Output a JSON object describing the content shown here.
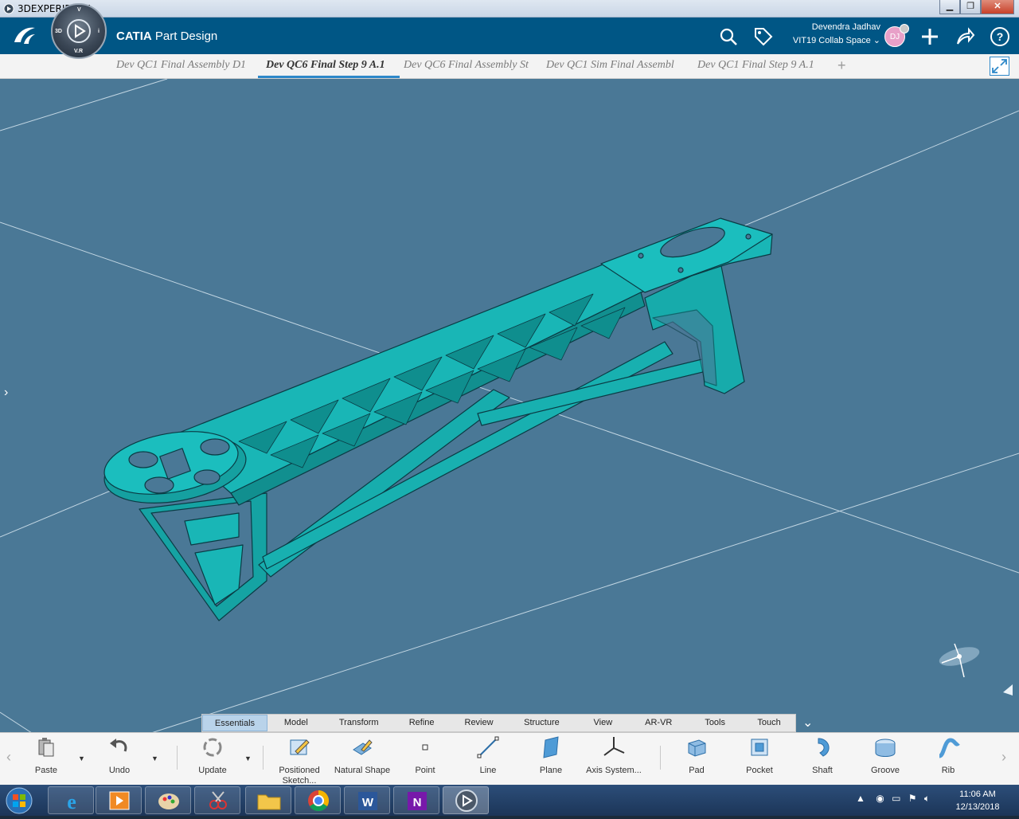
{
  "window": {
    "title": "3DEXPERIENCE"
  },
  "header": {
    "brand": "CATIA",
    "app_name": "Part Design",
    "compass": {
      "top": "V",
      "left": "3D",
      "right": "i",
      "bottom": "V.R"
    },
    "user": {
      "name": "Devendra Jadhav",
      "space": "VIT19 Collab Space",
      "initials": "DJ"
    },
    "icons": [
      "search-icon",
      "tag-icon",
      "plus-icon",
      "share-icon",
      "help-icon"
    ]
  },
  "tabs": [
    {
      "label": "Dev QC1 Final Assembly D1",
      "active": false
    },
    {
      "label": "Dev QC6 Final Step 9 A.1",
      "active": true
    },
    {
      "label": "Dev QC6 Final Assembly St",
      "active": false
    },
    {
      "label": "Dev QC1 Sim Final Assembl",
      "active": false
    },
    {
      "label": "Dev QC1 Final Step 9 A.1",
      "active": false
    }
  ],
  "tab_add": "+",
  "toolbar_tabs": [
    {
      "label": "Essentials",
      "active": true
    },
    {
      "label": "Model",
      "active": false
    },
    {
      "label": "Transform",
      "active": false
    },
    {
      "label": "Refine",
      "active": false
    },
    {
      "label": "Review",
      "active": false
    },
    {
      "label": "Structure",
      "active": false
    },
    {
      "label": "View",
      "active": false
    },
    {
      "label": "AR-VR",
      "active": false
    },
    {
      "label": "Tools",
      "active": false
    },
    {
      "label": "Touch",
      "active": false
    }
  ],
  "tools": {
    "paste": "Paste",
    "undo": "Undo",
    "update": "Update",
    "positioned_sketch": "Positioned Sketch...",
    "natural_shape": "Natural Shape",
    "point": "Point",
    "line": "Line",
    "plane": "Plane",
    "axis_system": "Axis System...",
    "pad": "Pad",
    "pocket": "Pocket",
    "shaft": "Shaft",
    "groove": "Groove",
    "rib": "Rib"
  },
  "taskbar": {
    "apps": [
      "internet-explorer-icon",
      "media-player-icon",
      "paint-icon",
      "snipping-tool-icon",
      "file-explorer-icon",
      "chrome-icon",
      "word-icon",
      "onenote-icon",
      "3dexperience-icon"
    ],
    "time": "11:06 AM",
    "date": "12/13/2018"
  },
  "colors": {
    "header": "#005685",
    "viewport": "#4a7896",
    "part": "#19b6b6",
    "accent": "#2d88c9"
  }
}
